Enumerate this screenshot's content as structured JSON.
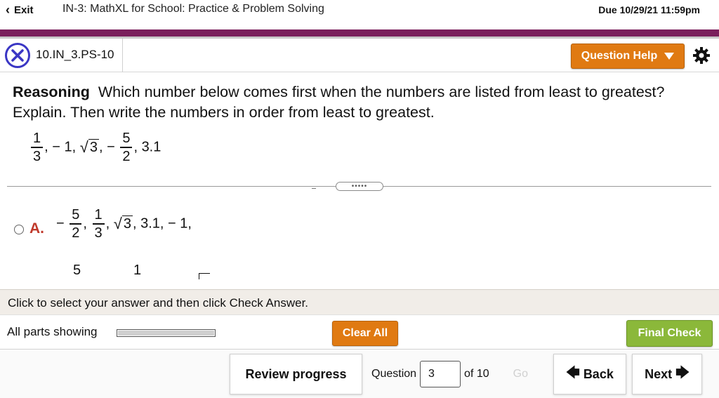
{
  "topbar": {
    "exit_label": "Exit",
    "app_title": "IN-3: MathXL for School: Practice & Problem Solving",
    "due": "Due 10/29/21 11:59pm"
  },
  "question_header": {
    "question_id": "10.IN_3.PS-10",
    "help_label": "Question Help"
  },
  "prompt": {
    "heading": "Reasoning",
    "text": "Which number below comes first when the numbers are listed from least to greatest? Explain. Then write the numbers in order from least to greatest."
  },
  "given_numbers": {
    "f1_num": "1",
    "f1_den": "3",
    "n2": "− 1,",
    "n3_radicand": "3",
    "f4_sign": "−",
    "f4_num": "5",
    "f4_den": "2",
    "n5": "3.1"
  },
  "option_a": {
    "label": "A.",
    "f1_sign": "−",
    "f1_num": "5",
    "f1_den": "2",
    "f2_num": "1",
    "f2_den": "3",
    "radicand": "3",
    "tail": ", 3.1, − 1,"
  },
  "partial_row": {
    "v1": "5",
    "v2": "1"
  },
  "instruction": "Click to select your answer and then click Check Answer.",
  "parts": {
    "label": "All parts showing",
    "progress": 1.0,
    "clear_label": "Clear All",
    "final_label": "Final Check"
  },
  "footer": {
    "review_label": "Review progress",
    "question_label": "Question",
    "question_value": "3",
    "of_label": "of 10",
    "go_label": "Go",
    "back_label": "Back",
    "next_label": "Next"
  },
  "colors": {
    "purple_bar": "#7a1f5c",
    "orange_button": "#e07a12",
    "green_button": "#8bb83a",
    "x_icon": "#3a36c4",
    "option_label": "#c0392b"
  }
}
